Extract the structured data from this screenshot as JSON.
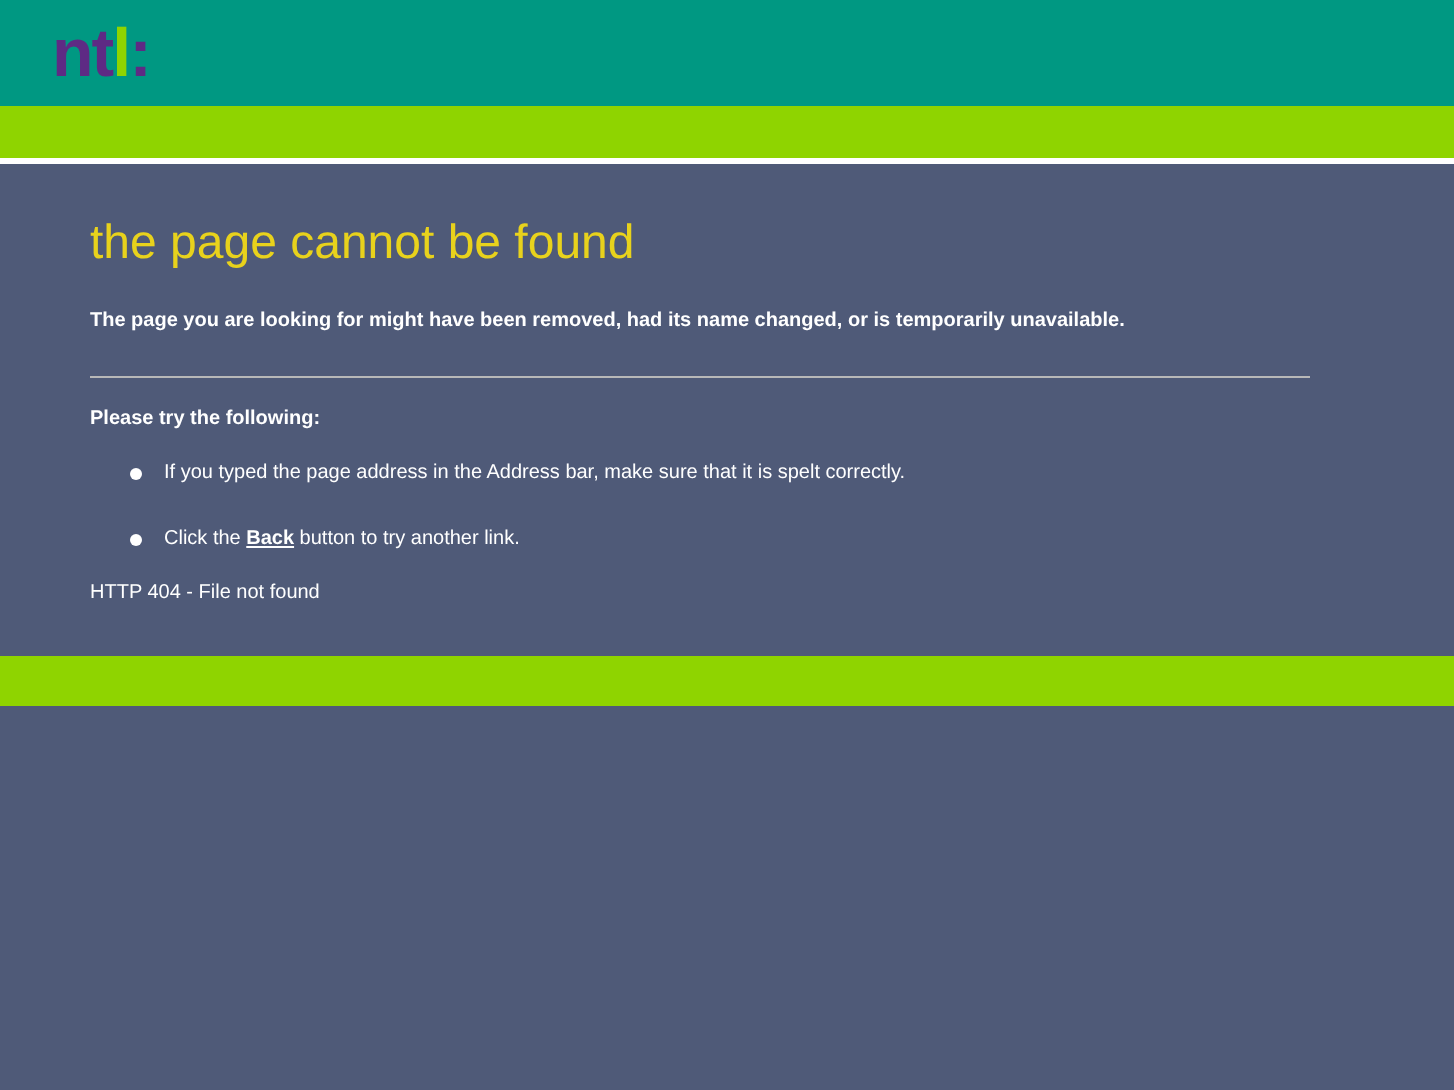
{
  "logo": [
    {
      "text": "n",
      "color": "#5e2a84"
    },
    {
      "text": "t",
      "color": "#5e2a84"
    },
    {
      "text": "l",
      "color": "#8fd400"
    },
    {
      "text": ":",
      "color": "#5e2a84"
    }
  ],
  "title": "the page cannot be found",
  "message": "The page you are looking for might have been removed, had its name changed, or is temporarily unavailable.",
  "suggestions_heading": "Please try the following:",
  "suggestions": [
    {
      "before": "If you typed the page address in the Address bar, make sure that it is spelt correctly."
    },
    {
      "before": "Click the ",
      "link": "Back",
      "after": " button to try another link."
    }
  ],
  "error_code": "HTTP 404 - File not found"
}
